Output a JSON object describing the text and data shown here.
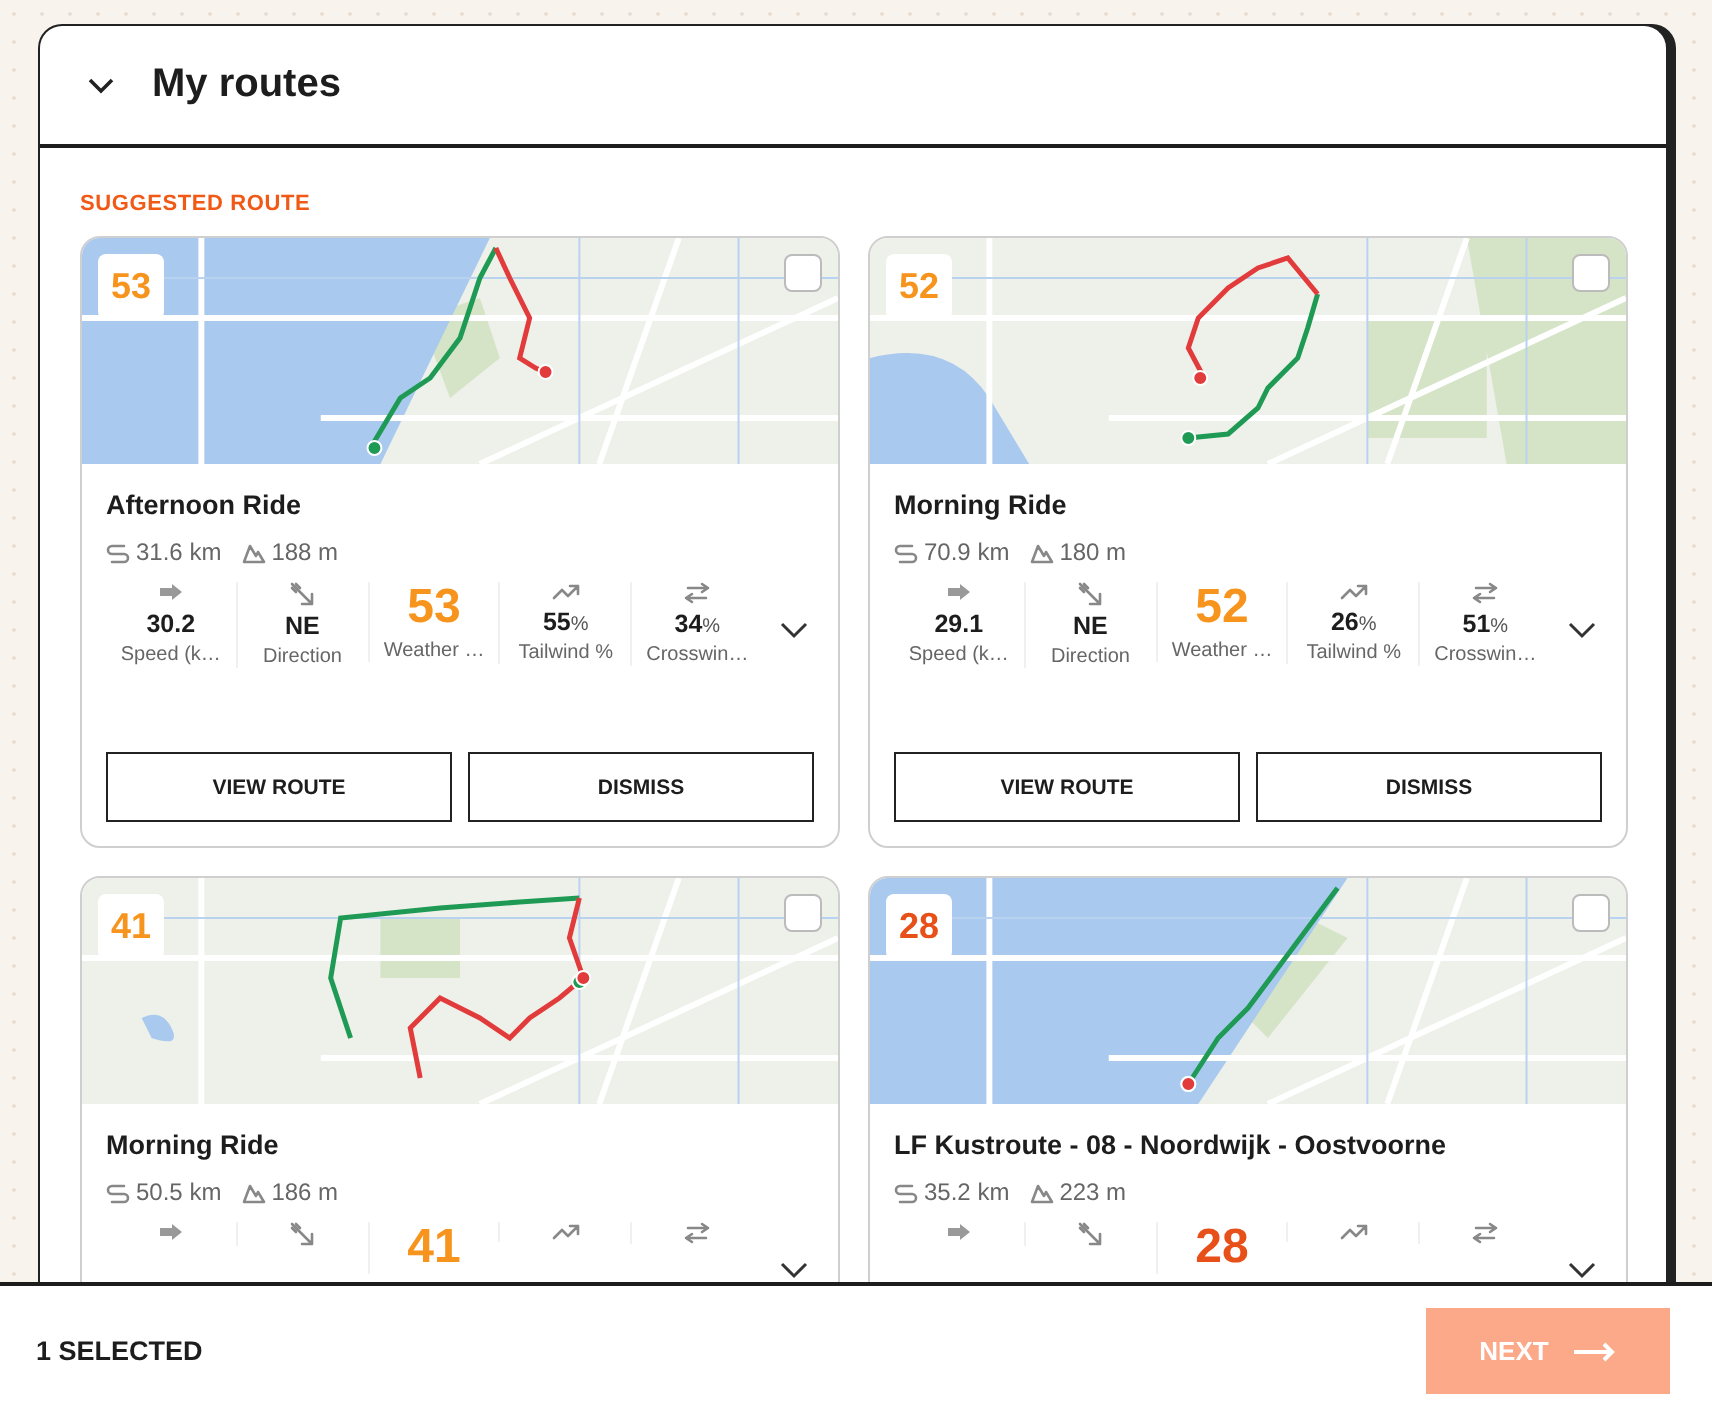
{
  "panel": {
    "title": "My routes",
    "expanded": true
  },
  "section_label": "SUGGESTED ROUTE",
  "routes": [
    {
      "name": "Afternoon Ride",
      "distance": "31.6 km",
      "elevation": "188 m",
      "score": "53",
      "color": "#f7941d",
      "selected": false,
      "stats": [
        {
          "kind": "speed",
          "value": "30.2",
          "label": "Speed (k…"
        },
        {
          "kind": "direction",
          "value": "NE",
          "label": "Direction"
        },
        {
          "kind": "score",
          "value": "53",
          "label": "Weather …"
        },
        {
          "kind": "tailwind",
          "value": "55",
          "unit": "%",
          "label": "Tailwind %"
        },
        {
          "kind": "crosswind",
          "value": "34",
          "unit": "%",
          "label": "Crosswin…"
        }
      ],
      "buttons": [
        "VIEW ROUTE",
        "DISMISS"
      ]
    },
    {
      "name": "Morning Ride",
      "distance": "70.9 km",
      "elevation": "180 m",
      "score": "52",
      "color": "#f7941d",
      "selected": false,
      "stats": [
        {
          "kind": "speed",
          "value": "29.1",
          "label": "Speed (k…"
        },
        {
          "kind": "direction",
          "value": "NE",
          "label": "Direction"
        },
        {
          "kind": "score",
          "value": "52",
          "label": "Weather …"
        },
        {
          "kind": "tailwind",
          "value": "26",
          "unit": "%",
          "label": "Tailwind %"
        },
        {
          "kind": "crosswind",
          "value": "51",
          "unit": "%",
          "label": "Crosswin…"
        }
      ],
      "buttons": [
        "VIEW ROUTE",
        "DISMISS"
      ]
    },
    {
      "name": "Morning Ride",
      "distance": "50.5 km",
      "elevation": "186 m",
      "score": "41",
      "color": "#f7941d",
      "selected": false,
      "stats": [
        {
          "kind": "speed"
        },
        {
          "kind": "direction"
        },
        {
          "kind": "score",
          "value": "41"
        },
        {
          "kind": "tailwind"
        },
        {
          "kind": "crosswind"
        }
      ]
    },
    {
      "name": "LF Kustroute - 08 - Noordwijk - Oostvoorne",
      "distance": "35.2 km",
      "elevation": "223 m",
      "score": "28",
      "color": "#e8501a",
      "selected": false,
      "stats": [
        {
          "kind": "speed"
        },
        {
          "kind": "direction"
        },
        {
          "kind": "score",
          "value": "28"
        },
        {
          "kind": "tailwind"
        },
        {
          "kind": "crosswind"
        }
      ]
    }
  ],
  "footer": {
    "selection": "1 SELECTED",
    "next_button": "NEXT"
  }
}
